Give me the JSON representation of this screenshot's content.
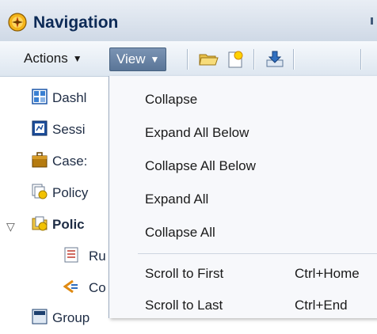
{
  "header": {
    "title": "Navigation"
  },
  "toolbar": {
    "actions_label": "Actions",
    "view_label": "View",
    "icons": [
      "open-folder-icon",
      "new-item-icon",
      "download-icon"
    ]
  },
  "tree": {
    "items": [
      {
        "label": "Dashl",
        "icon": "dashboard-icon"
      },
      {
        "label": "Sessi",
        "icon": "session-icon"
      },
      {
        "label": "Case:",
        "icon": "case-icon"
      },
      {
        "label": "Policy",
        "icon": "policy-icon"
      },
      {
        "label": "Polic",
        "icon": "policy-folder-icon",
        "toggle": "▽"
      },
      {
        "label": "Ru",
        "icon": "rules-icon"
      },
      {
        "label": "Co",
        "icon": "conditions-icon"
      },
      {
        "label": "Group",
        "icon": "group-icon"
      }
    ]
  },
  "menu": {
    "items": [
      {
        "label": "Collapse",
        "shortcut": ""
      },
      {
        "label": "Expand All Below",
        "shortcut": ""
      },
      {
        "label": "Collapse All Below",
        "shortcut": ""
      },
      {
        "label": "Expand All",
        "shortcut": ""
      },
      {
        "label": "Collapse All",
        "shortcut": ""
      },
      {
        "label": "Scroll to First",
        "shortcut": "Ctrl+Home"
      },
      {
        "label": "Scroll to Last",
        "shortcut": "Ctrl+End"
      }
    ]
  },
  "colors": {
    "header_title": "#0c2a56",
    "view_button": "#5a7597",
    "menu_background": "#f7f8fb"
  }
}
